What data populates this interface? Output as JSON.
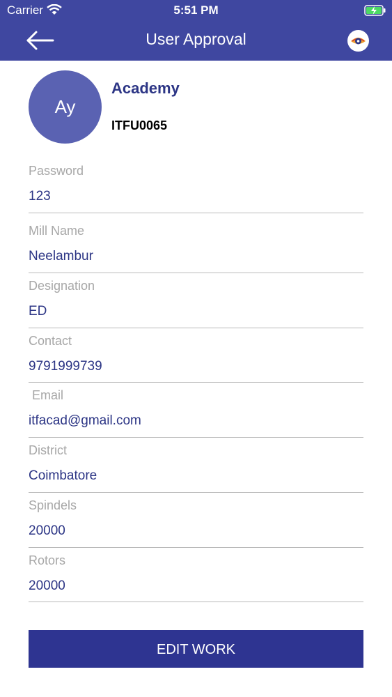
{
  "status_bar": {
    "carrier": "Carrier",
    "time": "5:51 PM"
  },
  "nav": {
    "title": "User Approval"
  },
  "profile": {
    "initials": "Ay",
    "name": "Academy",
    "id": "ITFU0065"
  },
  "fields": [
    {
      "label": "Password",
      "value": "123"
    },
    {
      "label": "Mill Name",
      "value": "Neelambur"
    },
    {
      "label": "Designation",
      "value": "ED"
    },
    {
      "label": "Contact",
      "value": "9791999739"
    },
    {
      "label": " Email",
      "value": "itfacad@gmail.com"
    },
    {
      "label": "District",
      "value": "Coimbatore"
    },
    {
      "label": "Spindels",
      "value": "20000"
    },
    {
      "label": "Rotors",
      "value": "20000"
    }
  ],
  "actions": {
    "edit_label": "EDIT WORK"
  },
  "colors": {
    "header": "#3f47a0",
    "accent_text": "#2c3585",
    "button": "#2e3491",
    "avatar": "#5a62b2"
  }
}
